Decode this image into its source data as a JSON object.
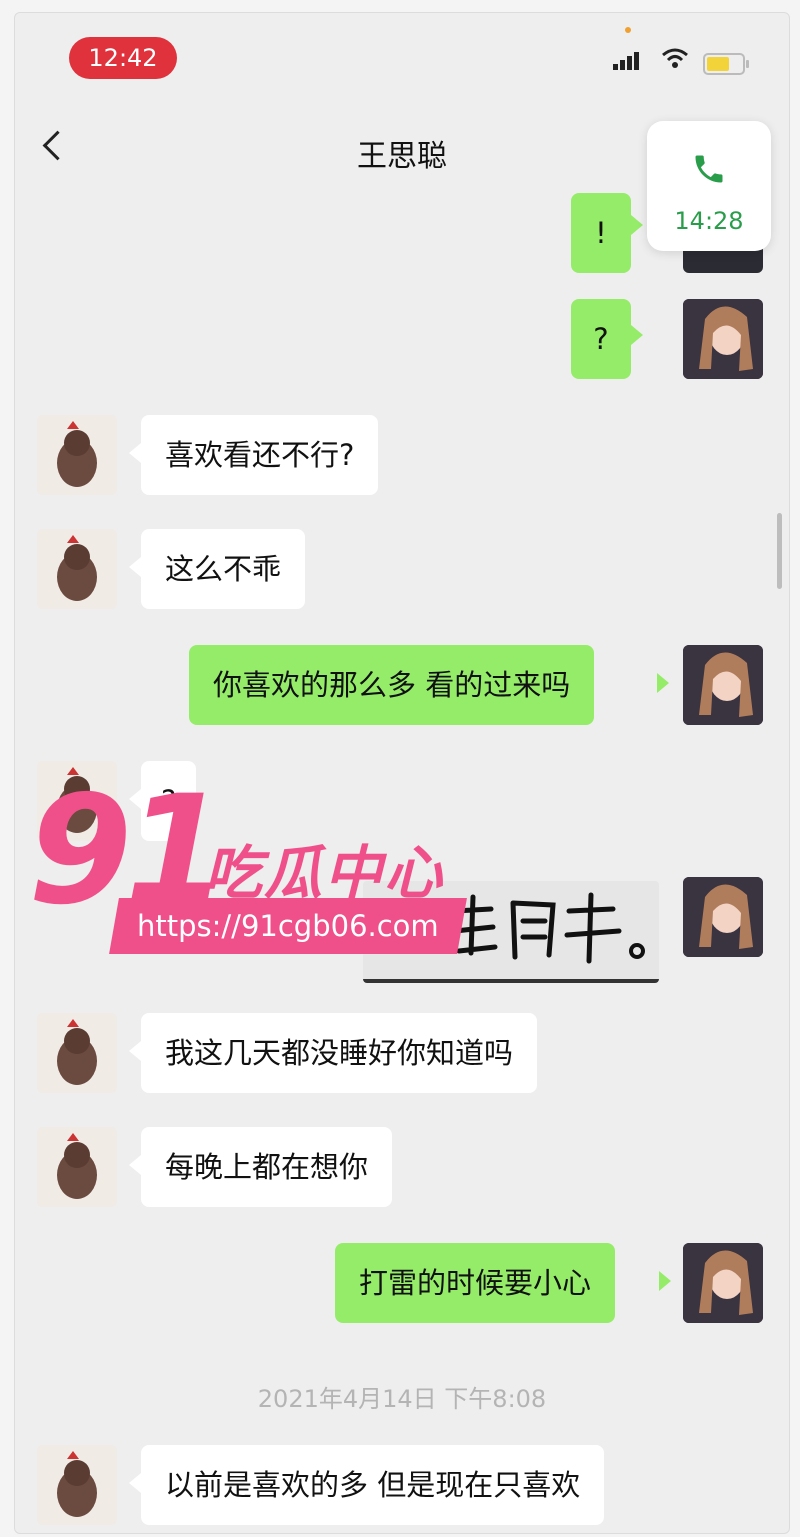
{
  "status": {
    "time": "12:42"
  },
  "nav": {
    "title": "王思聪"
  },
  "call": {
    "duration": "14:28"
  },
  "messages": {
    "m1": "!",
    "m2": "?",
    "m3": "喜欢看还不行?",
    "m4": "这么不乖",
    "m5": "你喜欢的那么多 看的过来吗",
    "m6": "?",
    "m8": "我这几天都没睡好你知道吗",
    "m9": "每晚上都在想你",
    "m10": "打雷的时候要小心",
    "m11": "以前是喜欢的多 但是现在只喜欢"
  },
  "handwriting": {
    "text": "我理解。"
  },
  "timestamp": "2021年4月14日 下午8:08",
  "watermark": {
    "number": "91",
    "text": "吃瓜中心",
    "url": "https://91cgb06.com"
  },
  "colors": {
    "bubble_out": "#95ec69",
    "bubble_in": "#ffffff",
    "accent": "#f0508a",
    "call_green": "#2a9d4b"
  }
}
